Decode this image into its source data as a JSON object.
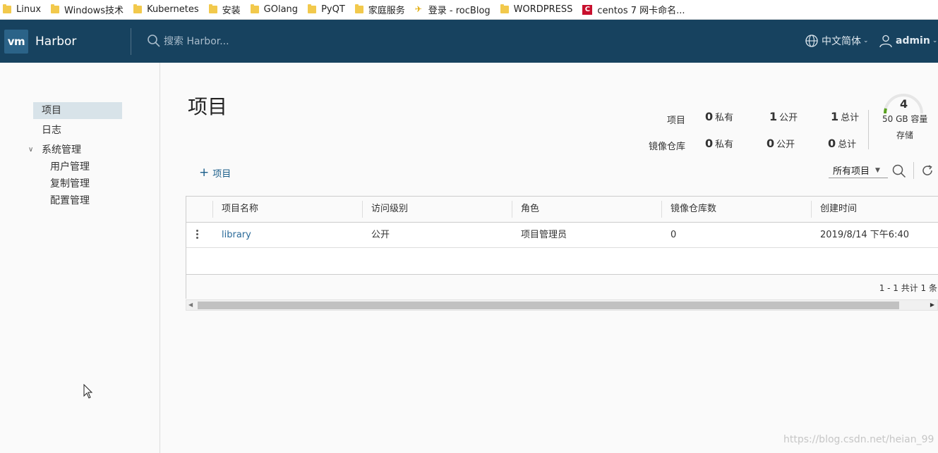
{
  "bookmarks": [
    {
      "label": "Linux",
      "icon": "folder-icon"
    },
    {
      "label": "Windows技术",
      "icon": "folder-icon"
    },
    {
      "label": "Kubernetes",
      "icon": "folder-icon"
    },
    {
      "label": "安装",
      "icon": "folder-icon"
    },
    {
      "label": "GOlang",
      "icon": "folder-icon"
    },
    {
      "label": "PyQT",
      "icon": "folder-icon"
    },
    {
      "label": "家庭服务",
      "icon": "folder-icon"
    },
    {
      "label": "登录 - rocBlog",
      "icon": "rocblog-icon"
    },
    {
      "label": "WORDPRESS",
      "icon": "folder-icon"
    },
    {
      "label": "centos 7 网卡命名...",
      "icon": "centos-icon"
    }
  ],
  "header": {
    "logo": "vm",
    "brand": "Harbor",
    "search_placeholder": "搜索 Harbor...",
    "language": "中文简体",
    "user": "admin",
    "bg_color": "#17425f"
  },
  "sidebar": {
    "projects": "项目",
    "logs": "日志",
    "system_admin": "系统管理",
    "sub_items": [
      "用户管理",
      "复制管理",
      "配置管理"
    ]
  },
  "main": {
    "title": "项目",
    "stats": {
      "projects_label": "项目",
      "repos_label": "镜像仓库",
      "projects_private_num": "0",
      "projects_private_label": "私有",
      "projects_public_num": "1",
      "projects_public_label": "公开",
      "projects_total_num": "1",
      "projects_total_label": "总计",
      "repos_private_num": "0",
      "repos_private_label": "私有",
      "repos_public_num": "0",
      "repos_public_label": "公开",
      "repos_total_num": "0",
      "repos_total_label": "总计"
    },
    "storage": {
      "count": "4",
      "capacity": "50 GB 容量",
      "label": "存储"
    },
    "add_project": "项目",
    "filter": "所有项目"
  },
  "table": {
    "columns": [
      "项目名称",
      "访问级别",
      "角色",
      "镜像仓库数",
      "创建时间"
    ],
    "rows": [
      {
        "name": "library",
        "access": "公开",
        "role": "项目管理员",
        "repo_count": "0",
        "created": "2019/8/14 下午6:40"
      }
    ],
    "footer": "1 - 1 共计 1 条"
  },
  "watermark": "https://blog.csdn.net/heian_99"
}
